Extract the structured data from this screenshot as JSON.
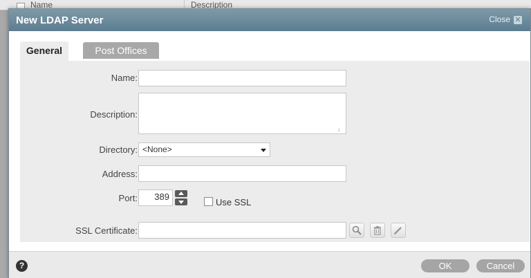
{
  "background": {
    "col1": "Name",
    "col2": "Description"
  },
  "dialog": {
    "title": "New LDAP Server",
    "close_label": "Close",
    "close_glyph": "✕"
  },
  "tabs": [
    {
      "label": "General",
      "active": true
    },
    {
      "label": "Post Offices",
      "active": false
    }
  ],
  "form": {
    "name_label": "Name:",
    "name_value": "",
    "description_label": "Description:",
    "description_value": "",
    "directory_label": "Directory:",
    "directory_value": "<None>",
    "address_label": "Address:",
    "address_value": "",
    "port_label": "Port:",
    "port_value": "389",
    "use_ssl_label": "Use SSL",
    "use_ssl_checked": false,
    "ssl_certificate_label": "SSL Certificate:",
    "ssl_certificate_value": ""
  },
  "icons": [
    "search-icon",
    "trash-icon",
    "pencil-icon",
    "help-icon"
  ],
  "footer": {
    "help_glyph": "?",
    "ok_label": "OK",
    "cancel_label": "Cancel"
  },
  "colors": {
    "titlebar": "#6a8a9c",
    "panel": "#ececec",
    "button": "#a5a5a5"
  }
}
